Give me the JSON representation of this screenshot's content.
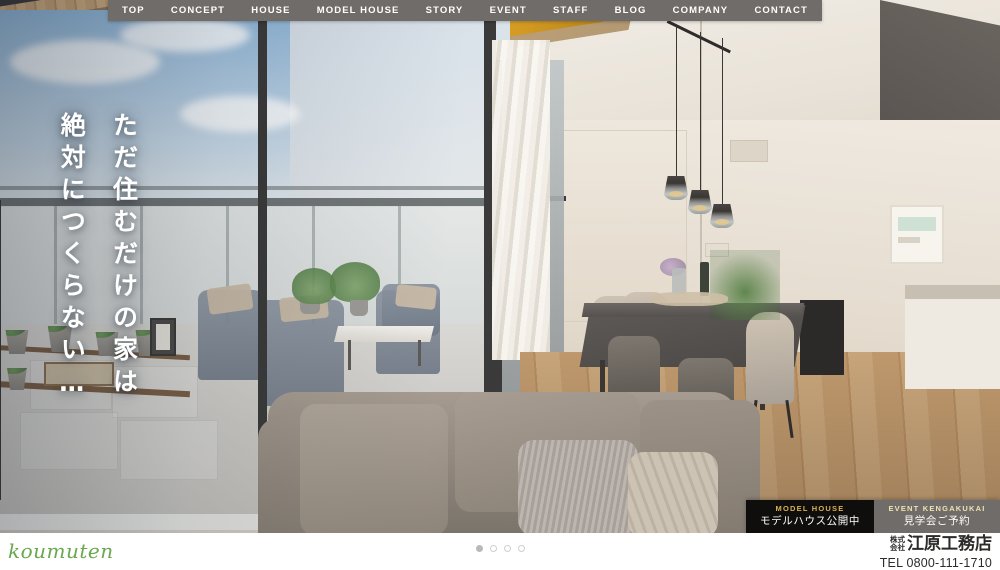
{
  "nav": {
    "items": [
      {
        "label": "TOP",
        "name": "nav-top"
      },
      {
        "label": "CONCEPT",
        "name": "nav-concept"
      },
      {
        "label": "HOUSE",
        "name": "nav-house"
      },
      {
        "label": "MODEL HOUSE",
        "name": "nav-model-house"
      },
      {
        "label": "STORY",
        "name": "nav-story"
      },
      {
        "label": "EVENT",
        "name": "nav-event"
      },
      {
        "label": "STAFF",
        "name": "nav-staff"
      },
      {
        "label": "BLOG",
        "name": "nav-blog"
      },
      {
        "label": "COMPANY",
        "name": "nav-company"
      },
      {
        "label": "CONTACT",
        "name": "nav-contact"
      }
    ],
    "background_color": "#6f6c69",
    "text_color": "#ffffff"
  },
  "hero": {
    "headline_line1": "ただ住むだけの家は",
    "headline_line2": "絶対につくらない…",
    "alt": "モデルハウス リビングとバルコニーの内観写真"
  },
  "cta": {
    "model_house": {
      "en": "MODEL HOUSE",
      "ja": "モデルハウス公開中",
      "background_color": "#100e0c",
      "accent_color": "#d8b152"
    },
    "event": {
      "en": "EVENT KENGAKUKAI",
      "ja": "見学会ご予約",
      "background_color": "#6f6c69",
      "accent_color": "#f0e2b0"
    }
  },
  "slider": {
    "dots": [
      {
        "active": true
      },
      {
        "active": false
      },
      {
        "active": false
      },
      {
        "active": false
      }
    ]
  },
  "footer": {
    "brand": "koumuten",
    "brand_color": "#6aa84f",
    "company_prefix_line1": "株式",
    "company_prefix_line2": "会社",
    "company_name": "江原工務店",
    "tel": "TEL 0800-111-1710"
  }
}
